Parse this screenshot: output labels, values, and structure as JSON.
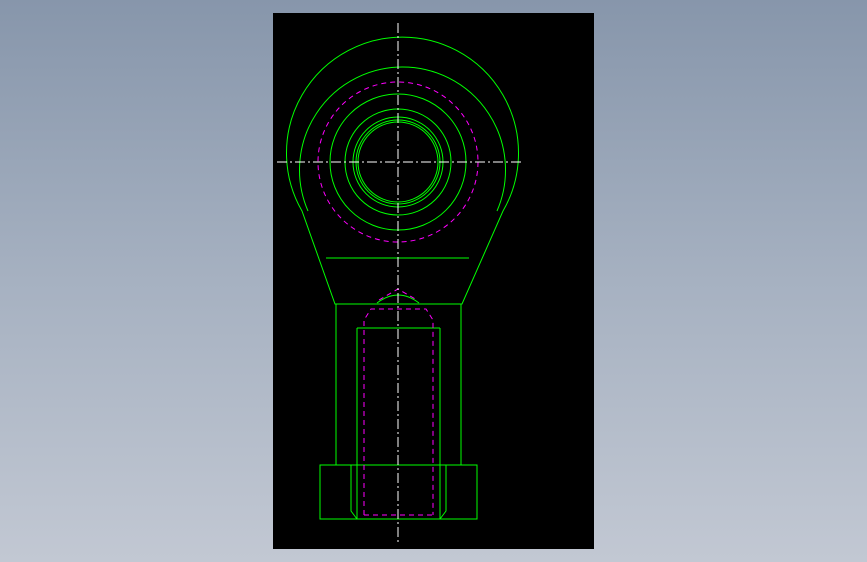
{
  "viewport": {
    "background_top": "#8796ab",
    "background_bottom": "#c2c8d3"
  },
  "drawing": {
    "subject": "rod end bearing",
    "canvas_background": "#000000",
    "colors": {
      "outline": "#00ff00",
      "hidden_line": "#ff00ff",
      "centerline": "#ffffff"
    },
    "line_types": {
      "outline": "solid",
      "hidden_line": "dashed",
      "centerline": "dash-dot"
    }
  }
}
